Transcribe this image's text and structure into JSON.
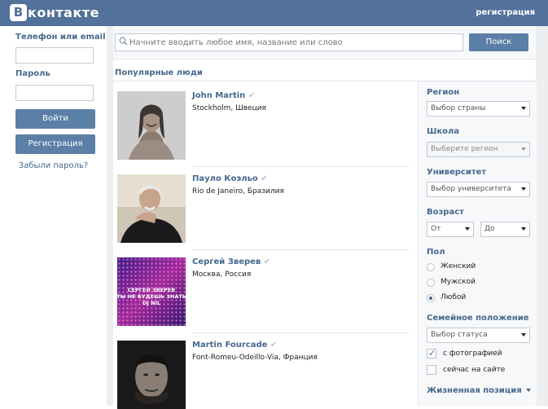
{
  "header": {
    "logo_letter": "В",
    "logo_text": "контакте",
    "register_link": "регистрация"
  },
  "login": {
    "phone_label": "Телефон или email",
    "password_label": "Пароль",
    "login_button": "Войти",
    "register_button": "Регистрация",
    "forgot_link": "Забыли пароль?"
  },
  "search": {
    "placeholder": "Начните вводить любое имя, название или слово",
    "button": "Поиск"
  },
  "section_title": "Популярные люди",
  "people": [
    {
      "name": "John Martin",
      "location": "Stockholm, Швеция"
    },
    {
      "name": "Пауло Коэльо",
      "location": "Rio de Janeiro, Бразилия"
    },
    {
      "name": "Сергей Зверев",
      "location": "Москва, Россия",
      "photo_text": [
        "СЕРГЕЙ ЗВЕРЕВ",
        "ТЫ НЕ БУДЕШЬ ЗНАТЬ",
        "DJ NIL"
      ]
    },
    {
      "name": "Martin Fourcade",
      "location": "Font-Romeu-Odeillo-Via, Франция"
    }
  ],
  "filters": {
    "region_label": "Регион",
    "region_value": "Выбор страны",
    "school_label": "Школа",
    "school_value": "Выберите регион",
    "university_label": "Университет",
    "university_value": "Выбор университета",
    "age_label": "Возраст",
    "age_from": "От",
    "age_dash": "-",
    "age_to": "До",
    "sex_label": "Пол",
    "sex_options": [
      "Женский",
      "Мужской",
      "Любой"
    ],
    "sex_selected": "Любой",
    "marital_label": "Семейное положение",
    "marital_value": "Выбор статуса",
    "with_photo": "с фотографией",
    "with_photo_checked": true,
    "online_now": "сейчас на сайте",
    "online_now_checked": false,
    "life_position": "Жизненная позиция"
  },
  "colors": {
    "header_bg": "#52719b",
    "link": "#45688e",
    "button": "#5b7fa6"
  }
}
